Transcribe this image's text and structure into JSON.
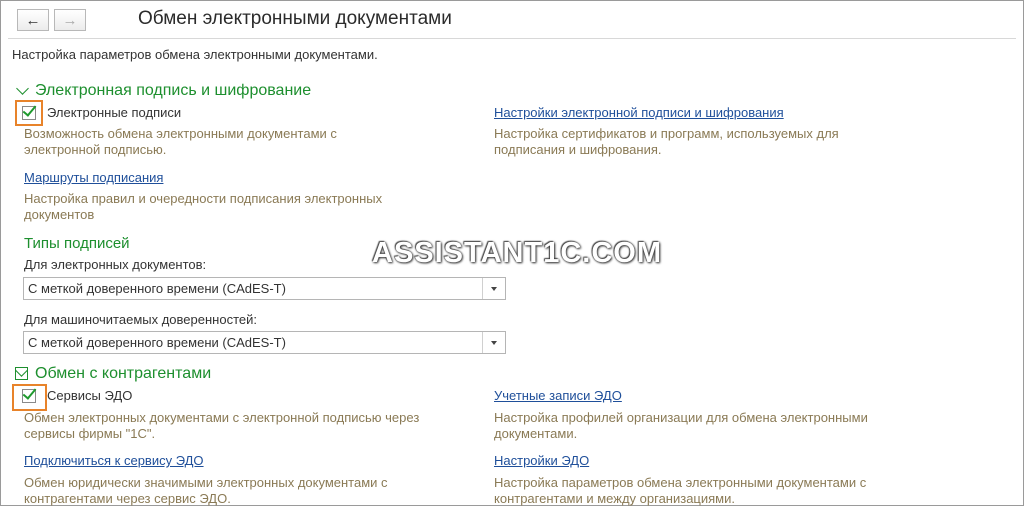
{
  "window": {
    "title": "Обмен электронными документами",
    "intro": "Настройка параметров обмена электронными документами."
  },
  "nav": {
    "back_icon": "←",
    "forward_icon": "→"
  },
  "sections": {
    "signature": {
      "title": "Электронная подпись и шифрование",
      "checkbox_label": "Электронные подписи",
      "checked": true,
      "checkbox_desc": "Возможность обмена электронными документами с электронной подписью.",
      "settings_link": "Настройки электронной подписи и шифрования",
      "settings_desc": "Настройка сертификатов и программ, используемых для подписания и шифрования.",
      "routes_link": "Маршруты подписания",
      "routes_desc": "Настройка правил и очередности подписания электронных документов"
    },
    "signature_types": {
      "title": "Типы подписей",
      "edoc_label": "Для электронных документов:",
      "edoc_value": "С меткой доверенного времени (CAdES-T)",
      "mpoa_label": "Для машиночитаемых доверенностей:",
      "mpoa_value": "С меткой доверенного времени (CAdES-T)"
    },
    "counterparties": {
      "title": "Обмен с контрагентами",
      "checkbox_label": "Сервисы ЭДО",
      "checked": true,
      "checkbox_desc": "Обмен электронных документами с электронной подписью через сервисы фирмы \"1С\".",
      "accounts_link": "Учетные записи ЭДО",
      "accounts_desc": "Настройка профилей организации для обмена электронными документами.",
      "connect_link": "Подключиться к сервису ЭДО",
      "connect_desc": "Обмен юридически значимыми электронных документами с контрагентами через сервис ЭДО.",
      "edo_settings_link": "Настройки ЭДО",
      "edo_settings_desc": "Настройка параметров обмена электронными документами с контрагентами и между организациями."
    }
  },
  "watermark": "ASSISTANT1C.COM",
  "colors": {
    "group_title": "#1d8f2e",
    "link": "#1f4f9a",
    "description": "#8a7a55",
    "highlight": "#e8832a"
  }
}
